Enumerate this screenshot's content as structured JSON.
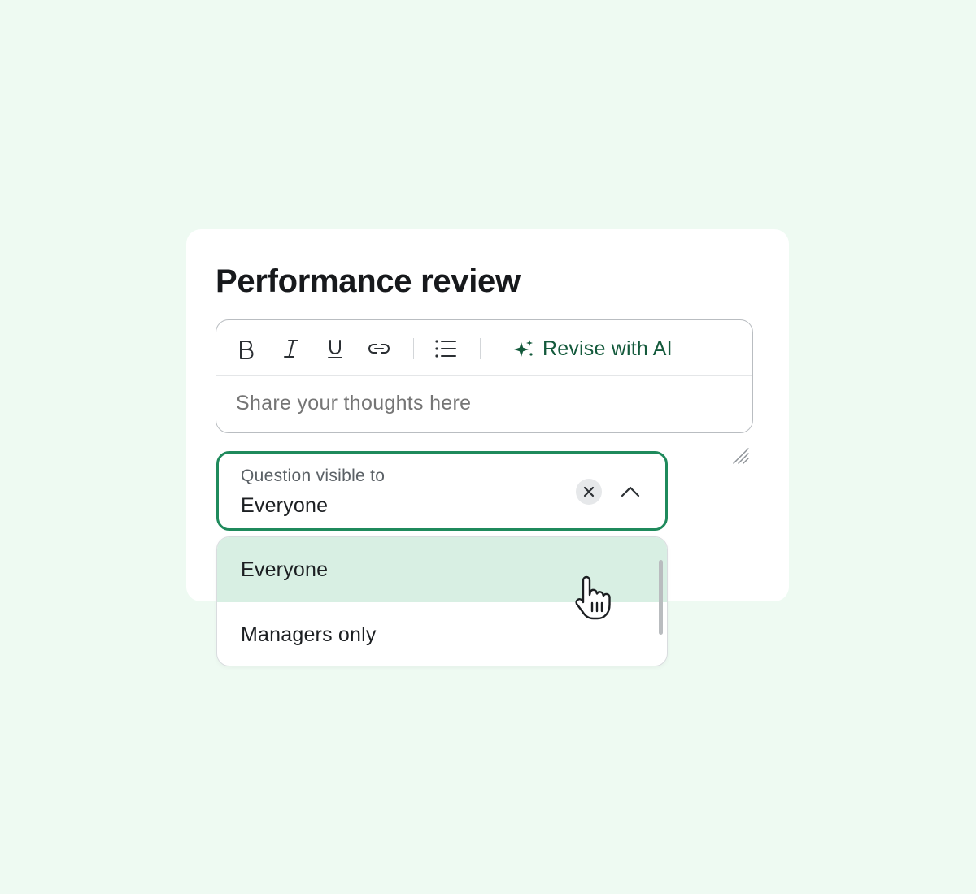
{
  "card": {
    "title": "Performance review"
  },
  "editor": {
    "toolbar": {
      "bold_icon": "bold-icon",
      "italic_icon": "italic-icon",
      "underline_icon": "underline-icon",
      "link_icon": "link-icon",
      "list_icon": "bulleted-list-icon",
      "ai_icon": "sparkle-icon",
      "ai_label": "Revise with AI"
    },
    "placeholder": "Share your thoughts here"
  },
  "visibility_select": {
    "label": "Question visible to",
    "value": "Everyone",
    "clear_icon": "close-icon",
    "toggle_icon": "chevron-up-icon",
    "options": [
      {
        "label": "Everyone",
        "selected": true
      },
      {
        "label": "Managers only",
        "selected": false
      }
    ]
  },
  "colors": {
    "background": "#eefaf2",
    "accent": "#1f8a5c",
    "ai_text": "#145a3c",
    "selected_option": "#d8efe3"
  }
}
